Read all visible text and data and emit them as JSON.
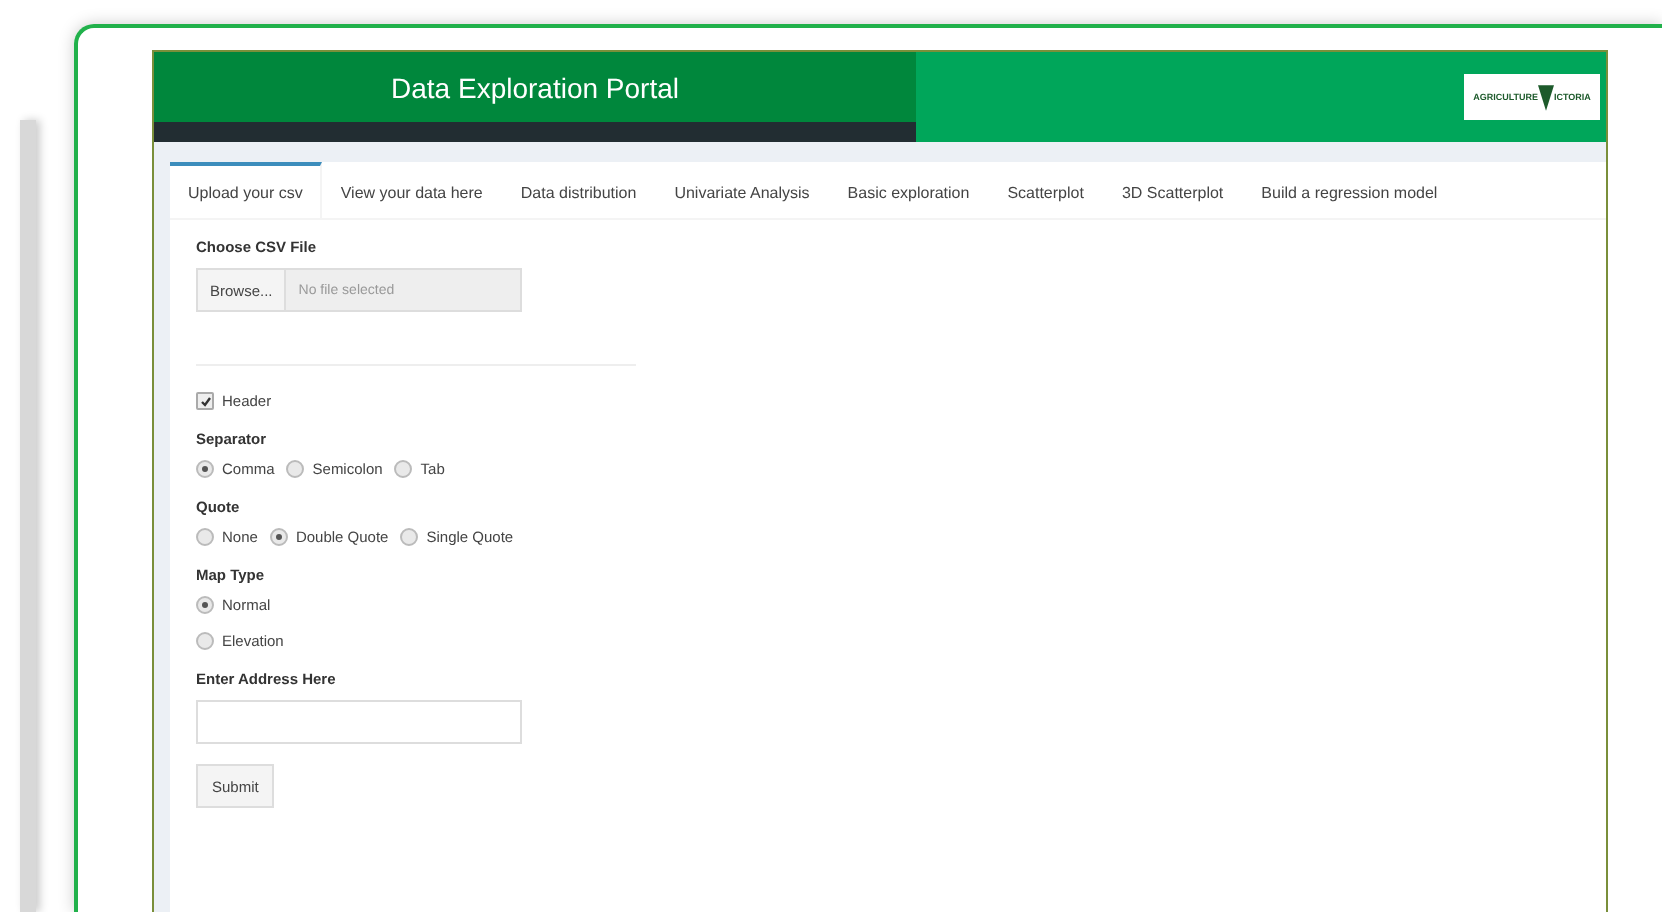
{
  "header": {
    "title": "Data Exploration Portal",
    "logo": [
      "AGRICULTURE",
      "ICTORIA"
    ]
  },
  "tabs": [
    {
      "label": "Upload your csv",
      "selected": true
    },
    {
      "label": "View your data here",
      "selected": false
    },
    {
      "label": "Data distribution",
      "selected": false
    },
    {
      "label": "Univariate Analysis",
      "selected": false
    },
    {
      "label": "Basic exploration",
      "selected": false
    },
    {
      "label": "Scatterplot",
      "selected": false
    },
    {
      "label": "3D Scatterplot",
      "selected": false
    },
    {
      "label": "Build a regression model",
      "selected": false
    }
  ],
  "file_input": {
    "label": "Choose CSV File",
    "button": "Browse...",
    "placeholder": "No file selected"
  },
  "header_checkbox": {
    "label": "Header",
    "checked": true
  },
  "radio_groups": [
    {
      "label": "Separator",
      "inline": true,
      "options": [
        {
          "label": "Comma",
          "selected": true
        },
        {
          "label": "Semicolon",
          "selected": false
        },
        {
          "label": "Tab",
          "selected": false
        }
      ]
    },
    {
      "label": "Quote",
      "inline": true,
      "options": [
        {
          "label": "None",
          "selected": false
        },
        {
          "label": "Double Quote",
          "selected": true
        },
        {
          "label": "Single Quote",
          "selected": false
        }
      ]
    },
    {
      "label": "Map Type",
      "inline": false,
      "options": [
        {
          "label": "Normal",
          "selected": true
        },
        {
          "label": "Elevation",
          "selected": false
        }
      ]
    }
  ],
  "address": {
    "label": "Enter Address Here"
  },
  "submit": "Submit"
}
